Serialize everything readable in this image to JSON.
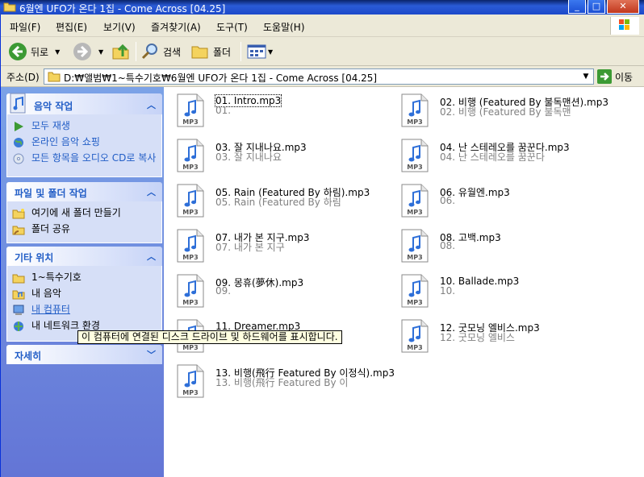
{
  "window": {
    "title": "6월엔 UFO가 온다 1집 - Come Across [04.25]",
    "min_glyph": "_",
    "max_glyph": "□",
    "close_glyph": "✕"
  },
  "menu": [
    "파일(F)",
    "편집(E)",
    "보기(V)",
    "즐겨찾기(A)",
    "도구(T)",
    "도움말(H)"
  ],
  "toolbar": {
    "back_label": "뒤로",
    "search_label": "검색",
    "folders_label": "폴더"
  },
  "address": {
    "label": "주소(D)",
    "path": "D:₩앨범₩1~특수기호₩6월엔 UFO가 온다 1집 - Come Across [04.25]",
    "go_label": "이동"
  },
  "taskpane": {
    "music": {
      "title": "음악 작업",
      "items": [
        "모두 재생",
        "온라인 음악 쇼핑",
        "모든 항목을 오디오 CD로 복사"
      ]
    },
    "file_folder": {
      "title": "파일 및 폴더 작업",
      "items": [
        "여기에 새 폴더 만들기",
        "폴더 공유"
      ]
    },
    "other": {
      "title": "기타 위치",
      "items": [
        "1~특수기호",
        "내 음악",
        "내 컴퓨터",
        "내 네트워크 환경"
      ]
    },
    "details": {
      "title": "자세히"
    }
  },
  "tooltip": "이 컴퓨터에 연결된 디스크 드라이브 및 하드웨어를 표시합니다.",
  "files": [
    {
      "name": "01. Intro.mp3",
      "sub": "01."
    },
    {
      "name": "02. 비행 (Featured By 불독맨션).mp3",
      "sub": "02. 비행 (Featured By 불독맨"
    },
    {
      "name": "03. 잘 지내나요.mp3",
      "sub": "03. 잘 지내나요"
    },
    {
      "name": "04. 난 스테레오를 꿈꾼다.mp3",
      "sub": "04. 난 스테레오를 꿈꾼다"
    },
    {
      "name": "05. Rain (Featured By 하림).mp3",
      "sub": "05. Rain (Featured By 하림"
    },
    {
      "name": "06. 유월엔.mp3",
      "sub": "06."
    },
    {
      "name": "07. 내가 본 지구.mp3",
      "sub": "07. 내가 본 지구"
    },
    {
      "name": "08. 고백.mp3",
      "sub": "08."
    },
    {
      "name": "09. 몽휴(夢休).mp3",
      "sub": "09."
    },
    {
      "name": "10. Ballade.mp3",
      "sub": "10."
    },
    {
      "name": "11. Dreamer.mp3",
      "sub": "11."
    },
    {
      "name": "12. 굿모닝 엘비스.mp3",
      "sub": "12. 굿모닝 엘비스"
    },
    {
      "name": "13. 비행(飛行 Featured By 이정식).mp3",
      "sub": "13. 비행(飛行 Featured By 이"
    }
  ],
  "mp3_badge": "MP3"
}
